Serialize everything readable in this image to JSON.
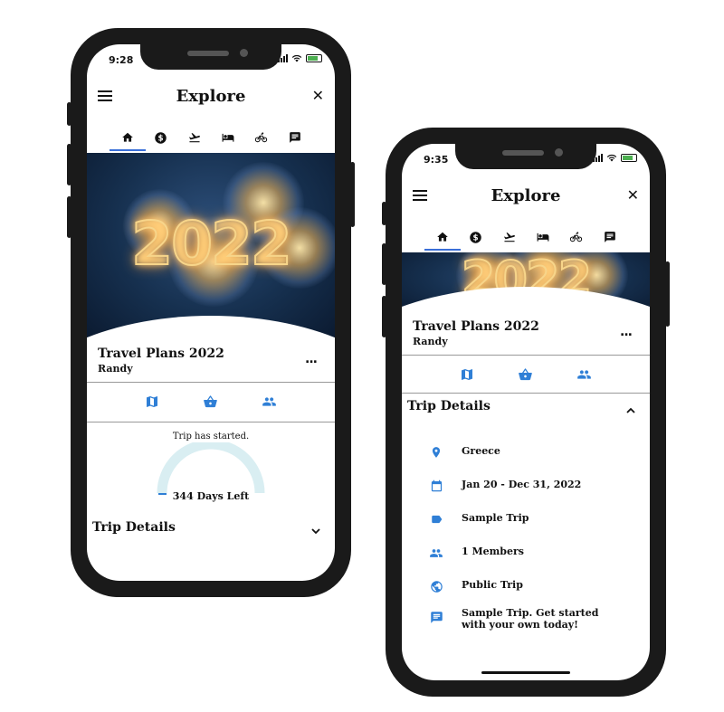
{
  "colors": {
    "accent": "#2f7fd6",
    "tab_underline": "#3a6fd8",
    "gauge_track": "#d9eef2"
  },
  "left_phone": {
    "status_time": "9:28",
    "title": "Explore",
    "tabs": [
      "home-icon",
      "money-icon",
      "flight-icon",
      "hotel-icon",
      "bike-icon",
      "chat-icon"
    ],
    "hero_year": "2022",
    "trip_name": "Travel Plans 2022",
    "trip_owner": "Randy",
    "more_label": "...",
    "progress_text": "Trip has started.",
    "days_left": "344 Days Left",
    "trip_details_label": "Trip Details"
  },
  "right_phone": {
    "status_time": "9:35",
    "title": "Explore",
    "hero_year": "2022",
    "trip_name": "Travel Plans 2022",
    "trip_owner": "Randy",
    "more_label": "...",
    "trip_details_label": "Trip Details",
    "details": [
      {
        "icon": "location-pin-icon",
        "text": "Greece"
      },
      {
        "icon": "calendar-icon",
        "text": "Jan 20 - Dec 31, 2022"
      },
      {
        "icon": "tag-icon",
        "text": "Sample Trip"
      },
      {
        "icon": "people-icon",
        "text": "1 Members"
      },
      {
        "icon": "globe-icon",
        "text": "Public Trip"
      },
      {
        "icon": "message-icon",
        "text": "Sample Trip. Get started with your own today!"
      }
    ]
  }
}
